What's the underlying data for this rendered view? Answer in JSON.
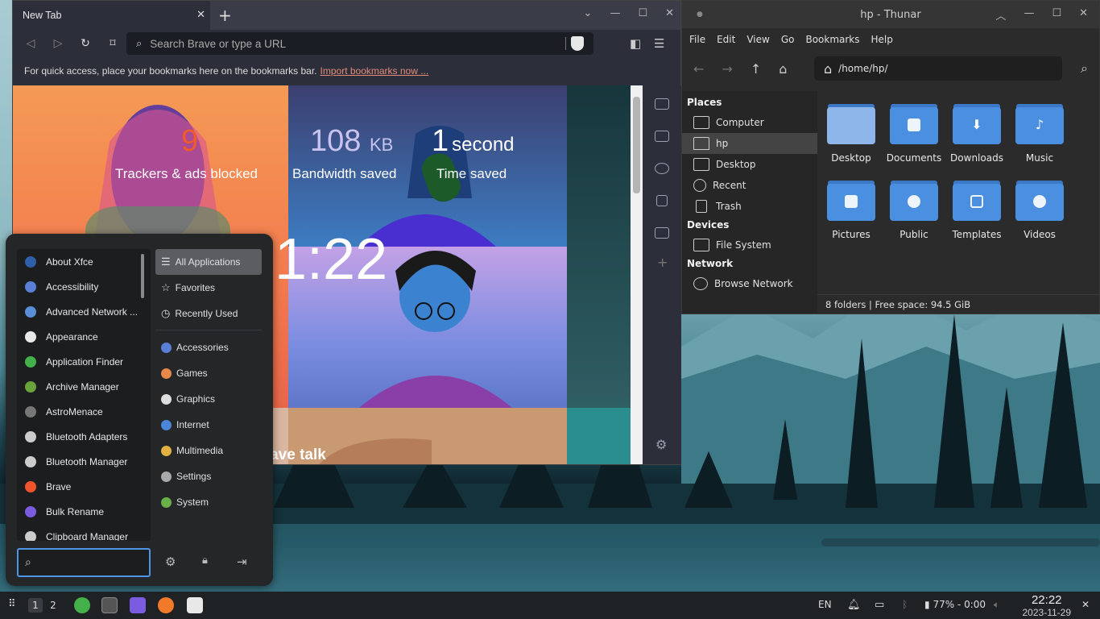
{
  "brave": {
    "tab_title": "New Tab",
    "url_placeholder": "Search Brave or type a URL",
    "bookmarks_hint": "For quick access, place your bookmarks here on the bookmarks bar.",
    "import_link": "Import bookmarks now ...",
    "stats": [
      {
        "value": "9",
        "unit": "",
        "label": "Trackers & ads blocked",
        "color": "#f15a2b"
      },
      {
        "value": "108",
        "unit": "KB",
        "label": "Bandwidth saved",
        "color": "#c9c3ef"
      },
      {
        "value": "1",
        "unit": "second",
        "label": "Time saved",
        "color": "#ffffff"
      }
    ],
    "clock": "1:22",
    "talk_label": "Brave talk"
  },
  "thunar": {
    "title": "hp - Thunar",
    "menu": [
      "File",
      "Edit",
      "View",
      "Go",
      "Bookmarks",
      "Help"
    ],
    "path": "/home/hp/",
    "sidebar": {
      "places_header": "Places",
      "places": [
        "Computer",
        "hp",
        "Desktop",
        "Recent",
        "Trash"
      ],
      "devices_header": "Devices",
      "devices": [
        "File System"
      ],
      "network_header": "Network",
      "network": [
        "Browse Network"
      ]
    },
    "folders": [
      "Desktop",
      "Documents",
      "Downloads",
      "Music",
      "Pictures",
      "Public",
      "Templates",
      "Videos"
    ],
    "status": "8 folders  |  Free space: 94.5 GiB"
  },
  "whisker": {
    "apps": [
      {
        "name": "About Xfce",
        "color": "#2e5fa8"
      },
      {
        "name": "Accessibility",
        "color": "#5b7fd6"
      },
      {
        "name": "Advanced Network ...",
        "color": "#5a8fd8"
      },
      {
        "name": "Appearance",
        "color": "#e8e8e8"
      },
      {
        "name": "Application Finder",
        "color": "#43b04a"
      },
      {
        "name": "Archive Manager",
        "color": "#6aa33a"
      },
      {
        "name": "AstroMenace",
        "color": "#777777"
      },
      {
        "name": "Bluetooth Adapters",
        "color": "#cccccc"
      },
      {
        "name": "Bluetooth Manager",
        "color": "#cccccc"
      },
      {
        "name": "Brave",
        "color": "#f0542d"
      },
      {
        "name": "Bulk Rename",
        "color": "#7b5ce0"
      },
      {
        "name": "Clipboard Manager",
        "color": "#cccccc"
      }
    ],
    "categories_top": [
      "All Applications",
      "Favorites",
      "Recently Used"
    ],
    "categories": [
      {
        "name": "Accessories",
        "color": "#5b7fd6"
      },
      {
        "name": "Games",
        "color": "#e8894a"
      },
      {
        "name": "Graphics",
        "color": "#dddddd"
      },
      {
        "name": "Internet",
        "color": "#4a86d8"
      },
      {
        "name": "Multimedia",
        "color": "#e0b040"
      },
      {
        "name": "Settings",
        "color": "#aaaaaa"
      },
      {
        "name": "System",
        "color": "#6ab04a"
      }
    ]
  },
  "taskbar": {
    "workspaces": [
      "1",
      "2"
    ],
    "language": "EN",
    "battery": "77% - 0:00",
    "time": "22:22",
    "date": "2023-11-29"
  }
}
